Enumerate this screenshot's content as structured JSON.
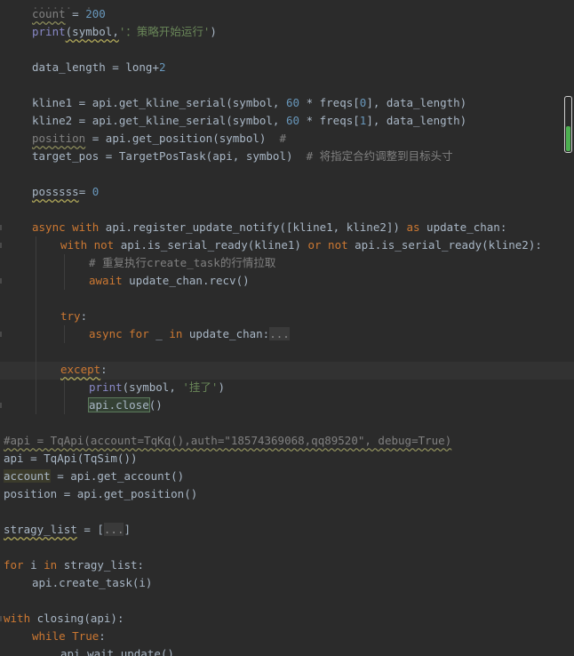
{
  "code": {
    "l1_a": "count",
    "l1_b": " = ",
    "l1_c": "200",
    "l2_a": "print",
    "l2_b": "(symbol,",
    "l2_c": "'：策略开始运行'",
    "l2_d": ")",
    "l3_a": "data_length = long+",
    "l3_b": "2",
    "l4_a": "kline1 = api.get_kline_serial(symbol, ",
    "l4_b": "60",
    "l4_c": " * freqs[",
    "l4_d": "0",
    "l4_e": "], data_length)",
    "l5_a": "kline2 = api.get_kline_serial(symbol, ",
    "l5_b": "60",
    "l5_c": " * freqs[",
    "l5_d": "1",
    "l5_e": "], data_length)",
    "l6_a": "position",
    "l6_b": " = api.get_position(symbol)  ",
    "l6_c": "#",
    "l7_a": "target_pos = TargetPosTask(api, symbol)  ",
    "l7_b": "# 将指定合约调整到目标头寸",
    "l8_a": "posssss",
    "l8_b": "= ",
    "l8_c": "0",
    "l9_a": "async with",
    "l9_b": " api.register_update_notify([kline1, kline2]) ",
    "l9_c": "as",
    "l9_d": " update_chan:",
    "l10_a": "with not",
    "l10_b": " api.is_serial_ready(kline1) ",
    "l10_c": "or not",
    "l10_d": " api.is_serial_ready(kline2):",
    "l11": "# 重复执行create_task的行情拉取",
    "l12_a": "await",
    "l12_b": " update_chan.recv()",
    "l13_a": "try",
    "l13_b": ":",
    "l14_a": "async for",
    "l14_b": " _ ",
    "l14_c": "in",
    "l14_d": " update_chan:",
    "l14_e": "...",
    "l15_a": "except",
    "l15_b": ":",
    "l16_a": "print",
    "l16_b": "(symbol, ",
    "l16_c": "'挂了'",
    "l16_d": ")",
    "l17_a": "api.close",
    "l17_b": "()",
    "l18": "#api = TqApi(account=TqKq(),auth=\"18574369068,qq89520\", debug=True)",
    "l19": "api = TqApi(TqSim())",
    "l20_a": "account",
    "l20_b": " = api.get_account()",
    "l21": "position = api.get_position()",
    "l22_a": "stragy_list",
    "l22_b": " = [",
    "l22_c": "...",
    "l22_d": "]",
    "l23_a": "for",
    "l23_b": " i ",
    "l23_c": "in",
    "l23_d": " stragy_list:",
    "l24": "api.create_task(i)",
    "l25_a": "with",
    "l25_b": " closing(api):",
    "l26_a": "while",
    "l26_b": " ",
    "l26_c": "True",
    "l26_d": ":",
    "l27": "api.wait_update()"
  },
  "colors": {
    "background": "#2b2b2b",
    "keyword": "#cc7832",
    "number": "#6897bb",
    "string": "#6a8759",
    "comment": "#808080",
    "text": "#a9b7c6",
    "scroll_indicator": "#4caf50"
  }
}
